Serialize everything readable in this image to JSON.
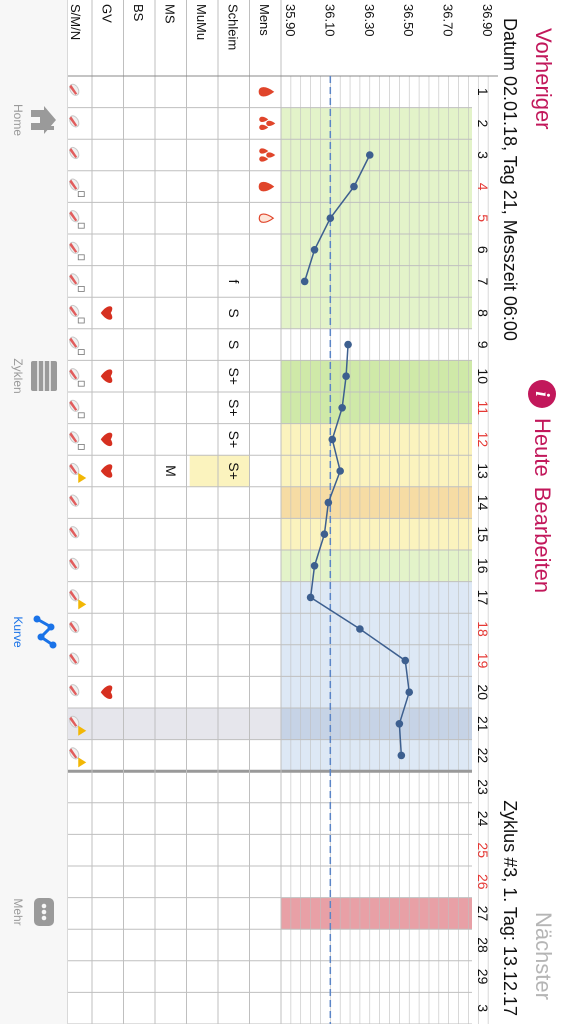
{
  "nav": {
    "prev_label": "Vorheriger",
    "today_label": "Heute",
    "edit_label": "Bearbeiten",
    "next_label": "Nächster"
  },
  "header": {
    "date_line": "Datum 02.01.18, Tag 21, Messzeit 06:00",
    "cycle_line": "Zyklus #3, 1. Tag: 13.12.17"
  },
  "tabs": [
    {
      "label": "Home"
    },
    {
      "label": "Zyklen"
    },
    {
      "label": "Kurve"
    },
    {
      "label": "Mehr"
    }
  ],
  "row_labels": [
    "Mens",
    "Schleim",
    "MuMu",
    "MS",
    "BS",
    "GV",
    "S/M/N"
  ],
  "colors": {
    "accent": "#c2185b",
    "tab_active": "#1a73e8",
    "curve": "#3d5f8f",
    "cover_line": "#5b85c7",
    "weekend_day": "#e53935",
    "phase_green": "#e3f3c9",
    "phase_green_dark": "#cfe9a8",
    "phase_yellow": "#fbf3be",
    "phase_orange": "#f6dca4",
    "phase_blue": "#dde8f5",
    "phase_blue_selected": "#c6d3e6",
    "red_block": "#e8a0a6",
    "grid": "#bfbfbf"
  },
  "chart_data": {
    "type": "line",
    "title": "",
    "xlabel": "",
    "ylabel": "",
    "y_ticks": [
      "36.90",
      "36.70",
      "36.50",
      "36.30",
      "36.10",
      "35.90"
    ],
    "ylim": [
      35.85,
      36.95
    ],
    "cover_line": 36.1,
    "x_days": [
      "1",
      "2",
      "3",
      "4",
      "5",
      "6",
      "7",
      "8",
      "9",
      "10",
      "11",
      "12",
      "13",
      "14",
      "15",
      "16",
      "17",
      "18",
      "19",
      "20",
      "21",
      "22",
      "23",
      "24",
      "25",
      "26",
      "27",
      "28",
      "29",
      "3"
    ],
    "red_days": [
      4,
      5,
      11,
      12,
      18,
      19,
      25,
      26
    ],
    "selected_day": 21,
    "series": [
      {
        "points": [
          [
            3,
            36.3
          ],
          [
            4,
            36.22
          ],
          [
            5,
            36.1
          ],
          [
            6,
            36.02
          ],
          [
            7,
            35.97
          ],
          [
            9,
            36.19
          ],
          [
            10,
            36.18
          ],
          [
            11,
            36.16
          ],
          [
            12,
            36.11
          ],
          [
            13,
            36.15
          ],
          [
            14,
            36.09
          ],
          [
            15,
            36.07
          ],
          [
            16,
            36.02
          ],
          [
            17,
            36.0
          ],
          [
            18,
            36.25
          ],
          [
            19,
            36.48
          ],
          [
            20,
            36.5
          ],
          [
            21,
            36.45
          ],
          [
            22,
            36.46
          ]
        ]
      }
    ],
    "phases": [
      {
        "from": 1,
        "to": 8,
        "color": "#e3f3c9"
      },
      {
        "from": 9,
        "to": 11,
        "color": "#cfe9a8"
      },
      {
        "from": 11,
        "to": 13,
        "color": "#fbf3be"
      },
      {
        "from": 13,
        "to": 14,
        "color": "#f6dca4"
      },
      {
        "from": 14,
        "to": 15,
        "color": "#fbf3be"
      },
      {
        "from": 15,
        "to": 16,
        "color": "#e3f3c9"
      },
      {
        "from": 16,
        "to": 20,
        "color": "#dde8f5"
      },
      {
        "from": 20,
        "to": 21,
        "color": "#c6d3e6"
      },
      {
        "from": 21,
        "to": 22,
        "color": "#dde8f5"
      },
      {
        "from": 26,
        "to": 27,
        "color": "#e8a0a6"
      }
    ],
    "mens": [
      {
        "day": 1,
        "icon": "drop-icon"
      },
      {
        "day": 2,
        "icon": "drops-icon"
      },
      {
        "day": 3,
        "icon": "drops-icon"
      },
      {
        "day": 4,
        "icon": "drop-icon"
      },
      {
        "day": 5,
        "icon": "drop-outline-icon"
      }
    ],
    "schleim": [
      {
        "day": 7,
        "value": "f"
      },
      {
        "day": 8,
        "value": "S"
      },
      {
        "day": 9,
        "value": "S"
      },
      {
        "day": 10,
        "value": "S+"
      },
      {
        "day": 11,
        "value": "S+"
      },
      {
        "day": 12,
        "value": "S+"
      },
      {
        "day": 13,
        "value": "S+"
      }
    ],
    "schleim_highlight": {
      "from": 13,
      "to": 16
    },
    "ms": [
      {
        "day": 13,
        "value": "M"
      }
    ],
    "gv_days": [
      8,
      10,
      12,
      13,
      20
    ],
    "smn_icons": [
      {
        "day": 1,
        "icon": "pill-icon"
      },
      {
        "day": 2,
        "icon": "pill-icon"
      },
      {
        "day": 3,
        "icon": "pill-icon"
      },
      {
        "day": 4,
        "icon": "pill-note-icon"
      },
      {
        "day": 5,
        "icon": "pill-note-icon"
      },
      {
        "day": 6,
        "icon": "pill-note-icon"
      },
      {
        "day": 7,
        "icon": "pill-note-icon"
      },
      {
        "day": 8,
        "icon": "pill-note-icon"
      },
      {
        "day": 9,
        "icon": "pill-note-icon"
      },
      {
        "day": 10,
        "icon": "pill-note-icon"
      },
      {
        "day": 11,
        "icon": "pill-note-icon"
      },
      {
        "day": 12,
        "icon": "pill-note-icon"
      },
      {
        "day": 13,
        "icon": "pill-warning-icon"
      },
      {
        "day": 14,
        "icon": "pill-icon"
      },
      {
        "day": 15,
        "icon": "pill-icon"
      },
      {
        "day": 16,
        "icon": "pill-icon"
      },
      {
        "day": 17,
        "icon": "pill-warning-icon"
      },
      {
        "day": 18,
        "icon": "pill-icon"
      },
      {
        "day": 19,
        "icon": "pill-icon"
      },
      {
        "day": 20,
        "icon": "pill-icon"
      },
      {
        "day": 21,
        "icon": "pill-warning-icon"
      },
      {
        "day": 22,
        "icon": "pill-warning-icon"
      }
    ]
  }
}
